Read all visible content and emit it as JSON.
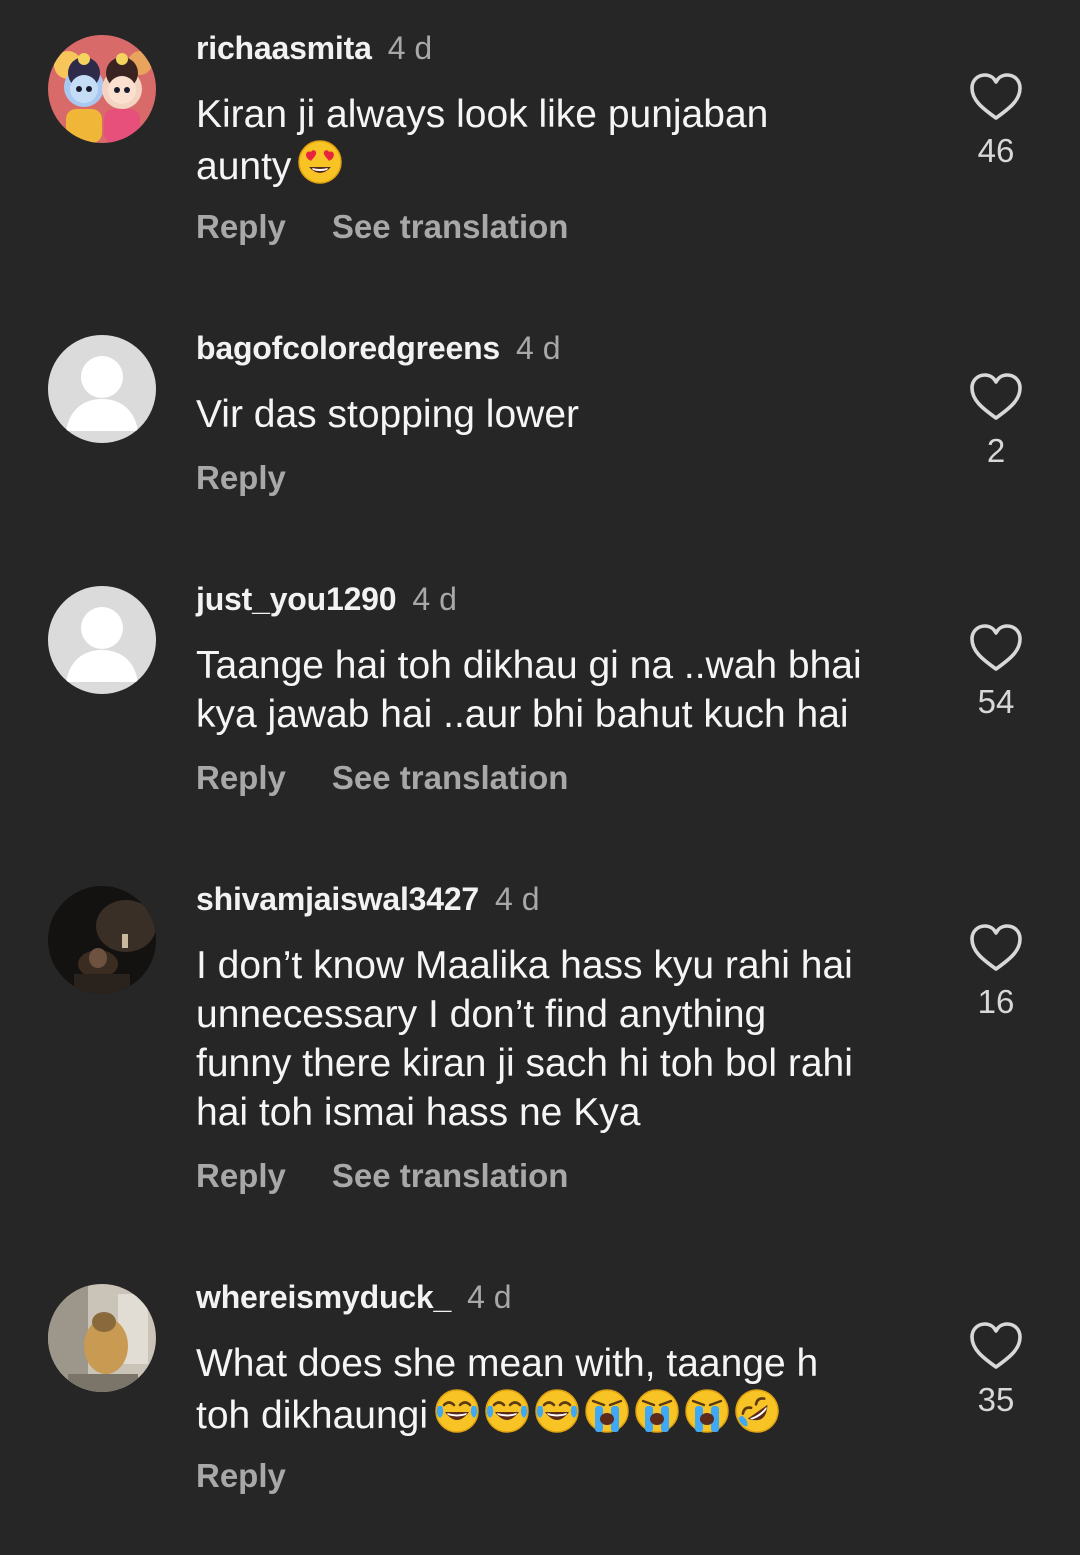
{
  "colors": {
    "background": "#262626",
    "text": "#f5f5f5",
    "muted": "#a8a8a8"
  },
  "comments": [
    {
      "username": "richaasmita",
      "time": "4 d",
      "text_lines": [
        "Kiran ji always look like punjaban",
        "aunty"
      ],
      "emojis": [
        "heart-eyes-emoji"
      ],
      "actions": {
        "reply": "Reply",
        "translate": "See translation"
      },
      "likes": "46",
      "avatar": "illustrated-avatar"
    },
    {
      "username": "bagofcoloredgreens",
      "time": "4 d",
      "text_lines": [
        "Vir das stopping lower"
      ],
      "actions": {
        "reply": "Reply"
      },
      "likes": "2",
      "avatar": "default-avatar"
    },
    {
      "username": "just_you1290",
      "time": "4 d",
      "text_lines": [
        "Taange hai toh dikhau gi na ..wah bhai",
        "kya jawab hai ..aur bhi bahut kuch hai"
      ],
      "actions": {
        "reply": "Reply",
        "translate": "See translation"
      },
      "likes": "54",
      "avatar": "default-avatar"
    },
    {
      "username": "shivamjaiswal3427",
      "time": "4 d",
      "text_lines": [
        "I don’t know Maalika hass kyu rahi  hai",
        "unnecessary I don’t find anything",
        "funny there kiran ji sach hi toh bol rahi",
        "hai toh ismai hass ne Kya"
      ],
      "actions": {
        "reply": "Reply",
        "translate": "See translation"
      },
      "likes": "16",
      "avatar": "photo-avatar-dark"
    },
    {
      "username": "whereismyduck_",
      "time": "4 d",
      "text_lines": [
        "What does she mean with, taange h",
        "toh dikhaungi"
      ],
      "emojis": [
        "tears-of-joy-emoji",
        "tears-of-joy-emoji",
        "tears-of-joy-emoji",
        "crying-emoji",
        "crying-emoji",
        "crying-emoji",
        "rolling-laughing-emoji"
      ],
      "actions": {
        "reply": "Reply"
      },
      "likes": "35",
      "avatar": "photo-avatar-light"
    }
  ]
}
